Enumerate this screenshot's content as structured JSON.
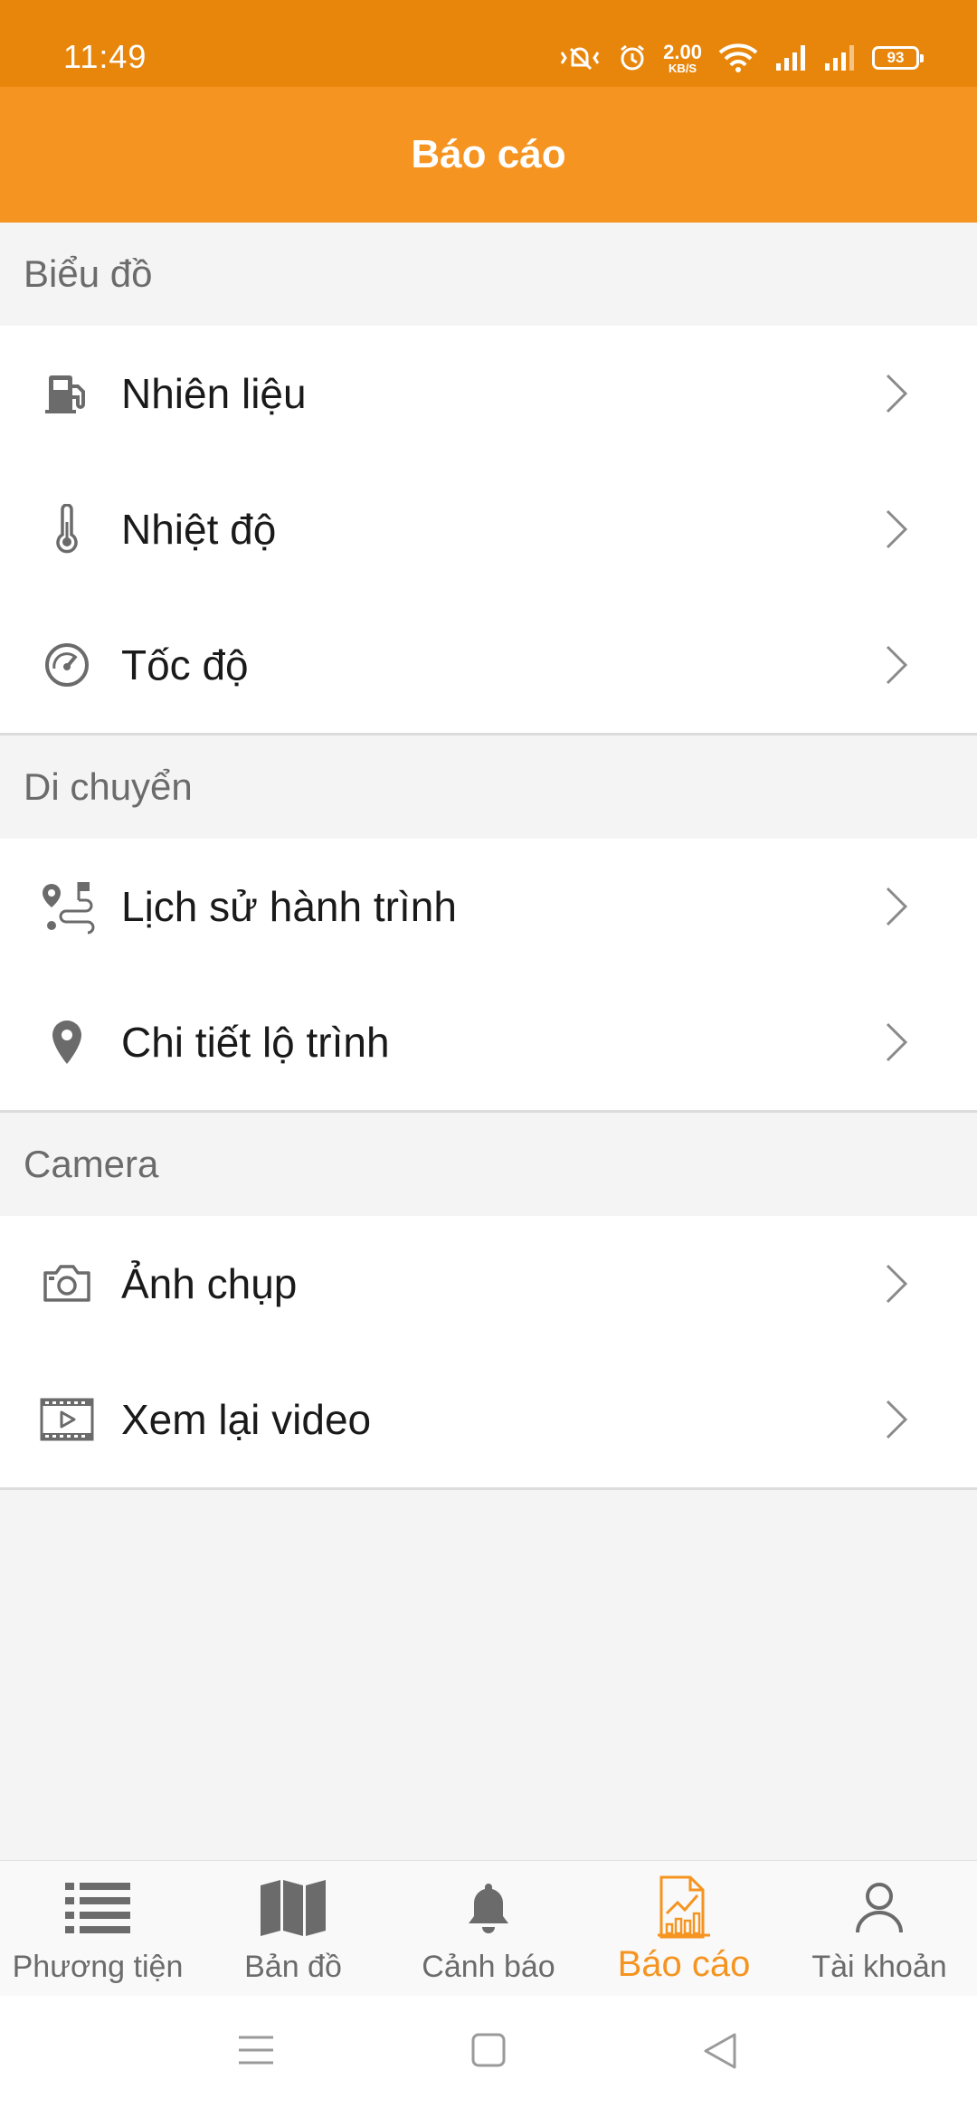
{
  "status_bar": {
    "time": "11:49",
    "net_speed_value": "2.00",
    "net_speed_unit": "KB/S",
    "battery": "93",
    "icons": [
      "vibrate-off-icon",
      "alarm-icon",
      "wifi-icon",
      "signal-1-icon",
      "signal-2-icon",
      "battery-icon"
    ]
  },
  "header": {
    "title": "Báo cáo"
  },
  "sections": [
    {
      "title": "Biểu đồ",
      "items": [
        {
          "label": "Nhiên liệu",
          "icon": "fuel-pump-icon"
        },
        {
          "label": "Nhiệt độ",
          "icon": "thermometer-icon"
        },
        {
          "label": "Tốc độ",
          "icon": "speedometer-icon"
        }
      ]
    },
    {
      "title": "Di chuyển",
      "items": [
        {
          "label": "Lịch sử hành trình",
          "icon": "route-history-icon"
        },
        {
          "label": "Chi tiết lộ trình",
          "icon": "map-pin-icon"
        }
      ]
    },
    {
      "title": "Camera",
      "items": [
        {
          "label": "Ảnh chụp",
          "icon": "camera-icon"
        },
        {
          "label": "Xem lại video",
          "icon": "video-playback-icon"
        }
      ]
    }
  ],
  "bottom_nav": [
    {
      "label": "Phương tiện",
      "icon": "list-icon",
      "active": false
    },
    {
      "label": "Bản đồ",
      "icon": "map-icon",
      "active": false
    },
    {
      "label": "Cảnh báo",
      "icon": "bell-icon",
      "active": false
    },
    {
      "label": "Báo cáo",
      "icon": "report-chart-icon",
      "active": true
    },
    {
      "label": "Tài khoản",
      "icon": "user-icon",
      "active": false
    }
  ],
  "colors": {
    "status_bar": "#e8860c",
    "header": "#f59420",
    "accent": "#f59420",
    "icon_gray": "#6b6b6b"
  }
}
